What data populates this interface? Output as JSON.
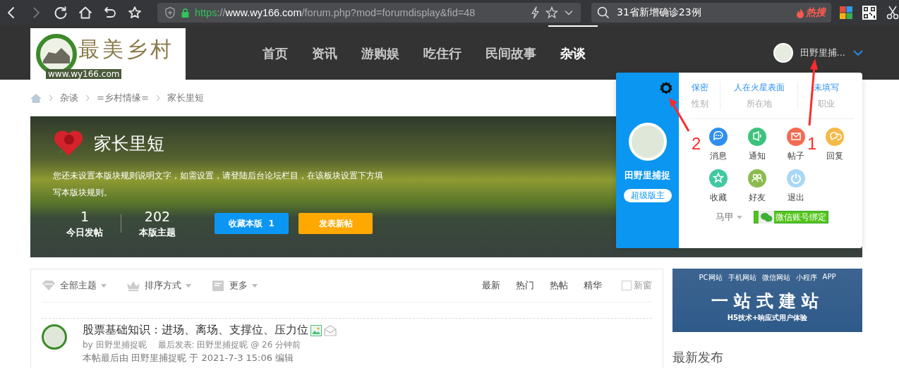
{
  "browser": {
    "url_parts": [
      {
        "text": "https",
        "kind": "scheme"
      },
      {
        "text": "://",
        "kind": "plain"
      },
      {
        "text": "www.wy166.com",
        "kind": "host"
      },
      {
        "text": "/forum.php?mod=forumdisplay&fid=48",
        "kind": "plain"
      }
    ],
    "search_text": "31省新增确诊23例",
    "search_badge": "热搜"
  },
  "header": {
    "logo": {
      "title": "最美乡村",
      "url": "www.wy166.com"
    },
    "nav": [
      {
        "label": "首页",
        "selected": false
      },
      {
        "label": "资讯",
        "selected": false
      },
      {
        "label": "游购娱",
        "selected": false
      },
      {
        "label": "吃住行",
        "selected": false
      },
      {
        "label": "民间故事",
        "selected": false
      },
      {
        "label": "杂谈",
        "selected": true
      }
    ],
    "user_name": "田野里捕..."
  },
  "breadcrumb": [
    "杂谈",
    "=乡村情缘=",
    "家长里短"
  ],
  "forum": {
    "title": "家长里短",
    "rules": "您还未设置本版块规则说明文字，如需设置，请登陆后台论坛栏目，在该板块设置下方填写本版块规则。",
    "stats": [
      {
        "value": "1",
        "label": "今日发帖"
      },
      {
        "value": "202",
        "label": "本版主题"
      }
    ],
    "buttons": [
      {
        "label": "收藏本版  1",
        "kind": "favorite"
      },
      {
        "label": "发表新帖",
        "kind": "post"
      }
    ]
  },
  "user_popup": {
    "name": "田野里捕捉",
    "role": "超级版主",
    "profile": [
      {
        "value": "保密",
        "label": "性别"
      },
      {
        "value": "人在火星表面",
        "label": "所在地"
      },
      {
        "value": "未填写",
        "label": "职业"
      }
    ],
    "actions": [
      {
        "label": "消息",
        "kind": "message",
        "color": "#2f8ff0"
      },
      {
        "label": "通知",
        "kind": "notice",
        "color": "#3cc37c"
      },
      {
        "label": "帖子",
        "kind": "mail",
        "color": "#f36b52"
      },
      {
        "label": "回复",
        "kind": "reply",
        "color": "#f5b947"
      },
      {
        "label": "收藏",
        "kind": "star",
        "color": "#40c9a2"
      },
      {
        "label": "好友",
        "kind": "friends",
        "color": "#8bbb4f"
      },
      {
        "label": "退出",
        "kind": "power",
        "color": "#a8d8f6"
      }
    ],
    "alt_account": "马甲",
    "wechat_button": "微信账号绑定"
  },
  "annotations": [
    {
      "label": "2",
      "kind": "diagonal"
    },
    {
      "label": "1",
      "kind": "vertical"
    }
  ],
  "thread_list": {
    "filters": [
      {
        "label": "全部主题",
        "kind": "gem"
      },
      {
        "label": "排序方式",
        "kind": "crown"
      },
      {
        "label": "更多",
        "kind": "box"
      }
    ],
    "tabs": [
      {
        "label": "最新",
        "selected": false
      },
      {
        "label": "热门",
        "selected": false
      },
      {
        "label": "热帖",
        "selected": false
      },
      {
        "label": "精华",
        "selected": false
      }
    ],
    "new_window": {
      "label": "新窗",
      "checked": false
    },
    "threads": [
      {
        "title": "股票基础知识：进场、离场、支撑位、压力位",
        "author": "by 田野里捕捉昵",
        "last_post": "最后发表: 田野里捕捉昵 @ 26 分钟前",
        "excerpt": "本帖最后由 田野里捕捉昵 于 2021-7-3 15:06 编辑"
      }
    ]
  },
  "sidebar": {
    "ad": {
      "labels": [
        "PC网站",
        "手机网站",
        "微信网站",
        "小程序",
        "APP"
      ],
      "headline": "一站式建站",
      "tagline": "H5技术+响应式用户体验"
    },
    "section_title": "最新发布"
  }
}
